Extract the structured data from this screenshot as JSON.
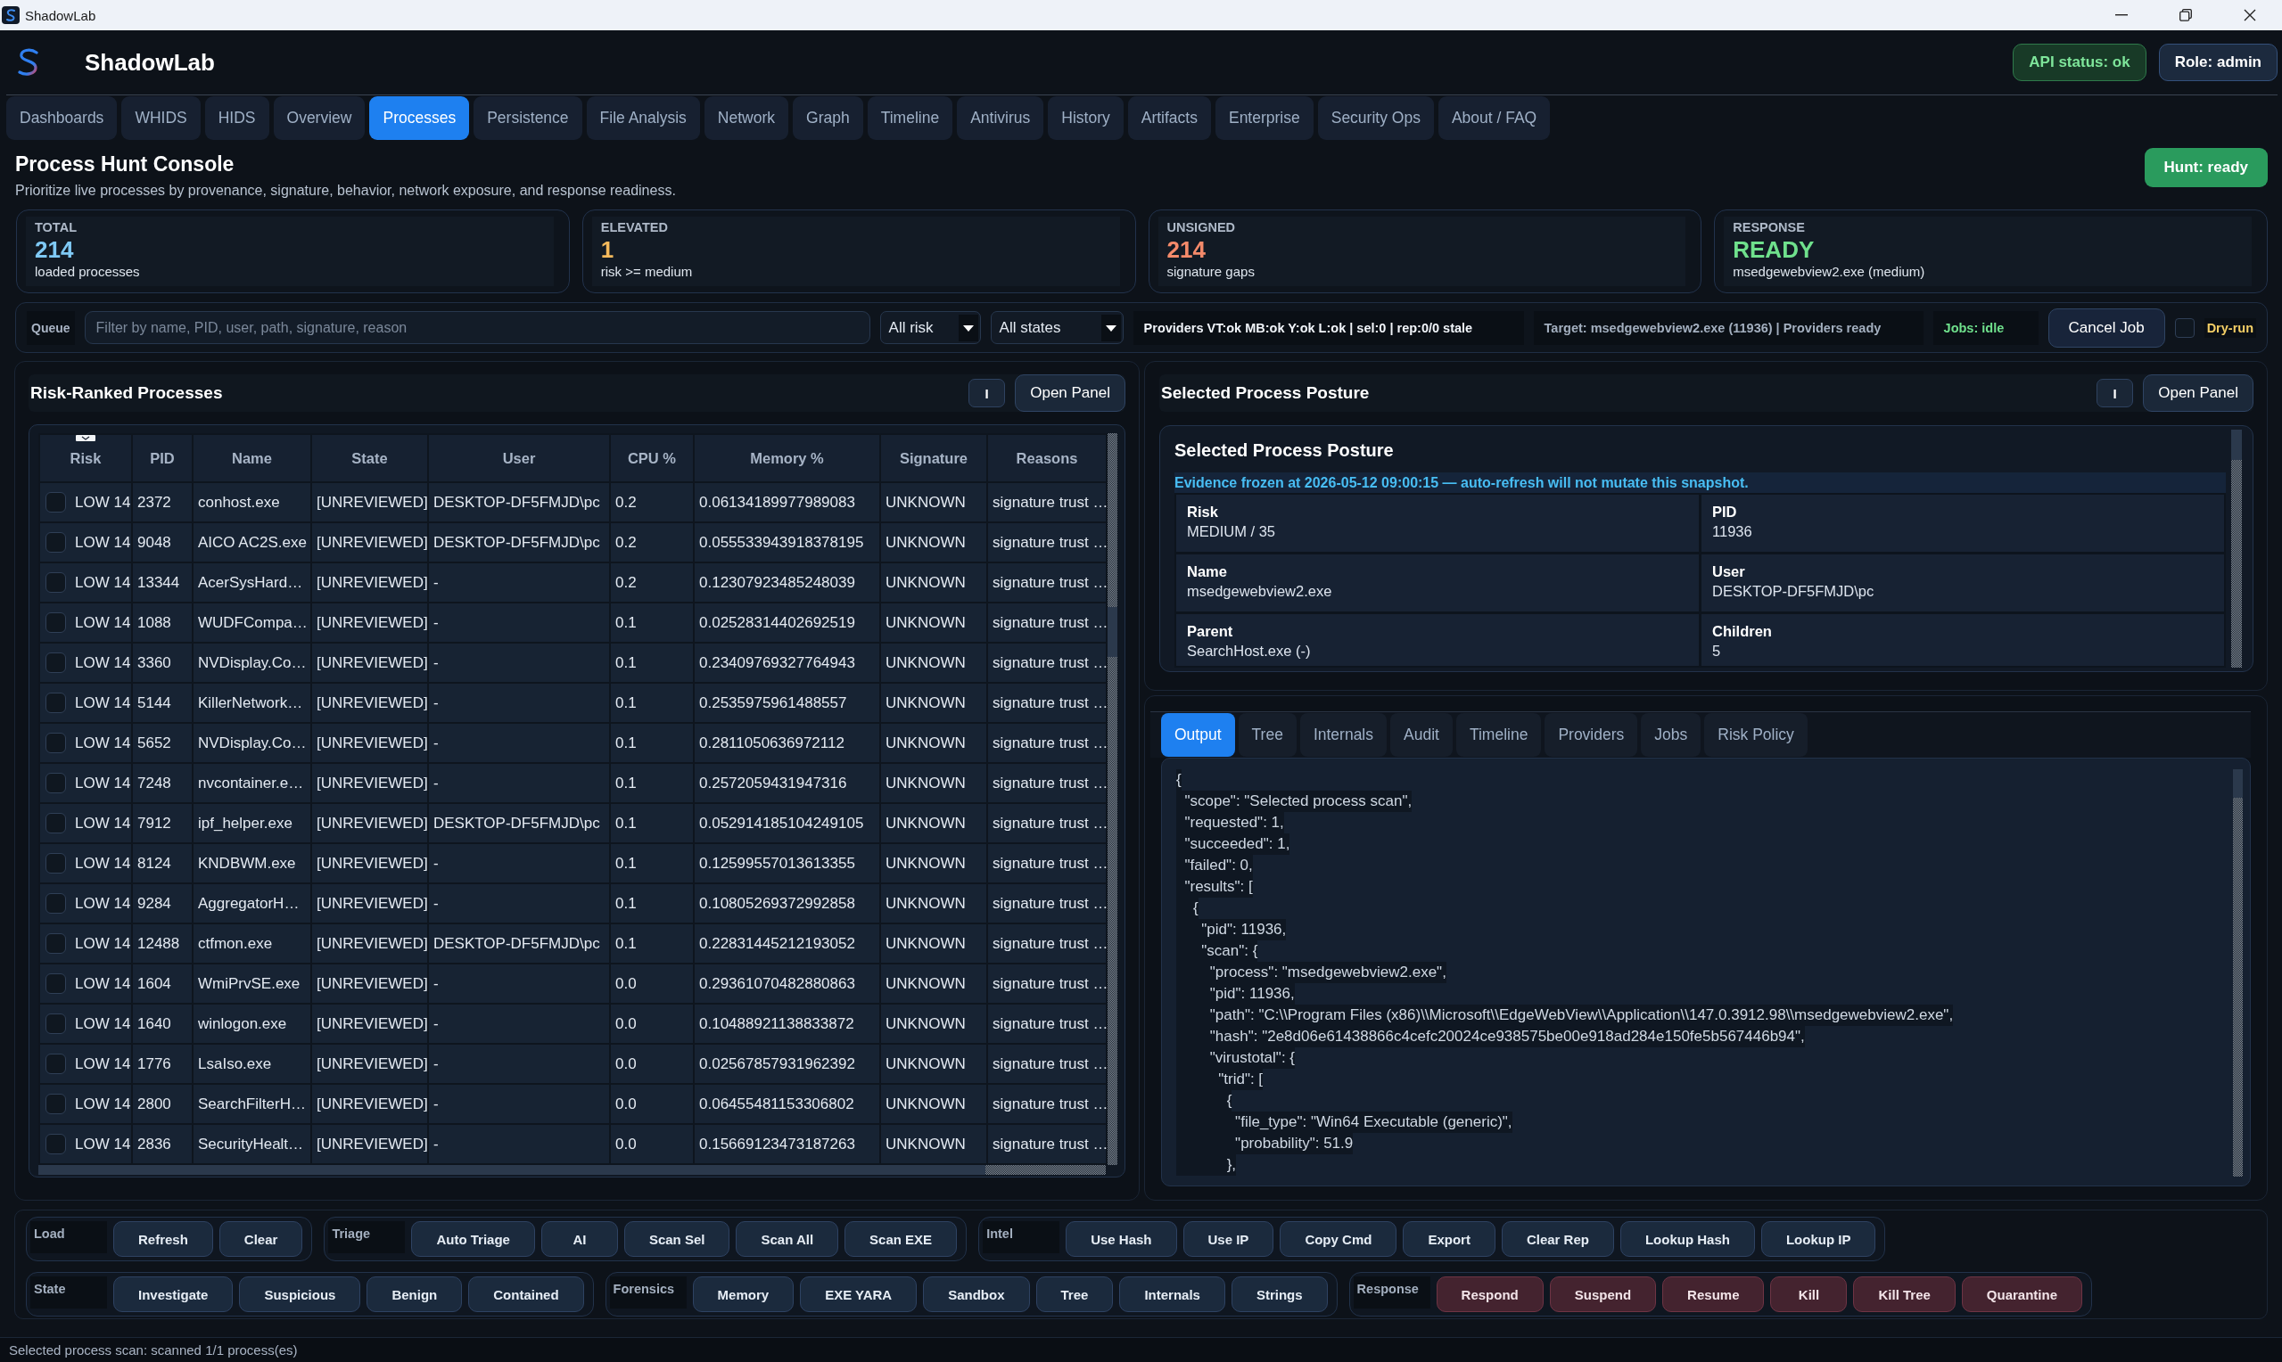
{
  "window": {
    "title": "ShadowLab"
  },
  "header": {
    "title": "ShadowLab",
    "badges": [
      {
        "label": "API status: ok",
        "kind": "ok"
      },
      {
        "label": "Role: admin",
        "kind": "neutral"
      }
    ]
  },
  "tabs": [
    {
      "label": "Dashboards",
      "selected": false
    },
    {
      "label": "WHIDS",
      "selected": false
    },
    {
      "label": "HIDS",
      "selected": false
    },
    {
      "label": "Overview",
      "selected": false
    },
    {
      "label": "Processes",
      "selected": true
    },
    {
      "label": "Persistence",
      "selected": false
    },
    {
      "label": "File Analysis",
      "selected": false
    },
    {
      "label": "Network",
      "selected": false
    },
    {
      "label": "Graph",
      "selected": false
    },
    {
      "label": "Timeline",
      "selected": false
    },
    {
      "label": "Antivirus",
      "selected": false
    },
    {
      "label": "History",
      "selected": false
    },
    {
      "label": "Artifacts",
      "selected": false
    },
    {
      "label": "Enterprise",
      "selected": false
    },
    {
      "label": "Security Ops",
      "selected": false
    },
    {
      "label": "About / FAQ",
      "selected": false
    }
  ],
  "page": {
    "title": "Process Hunt Console",
    "subtitle": "Prioritize live processes by provenance, signature, behavior, network exposure, and response readiness.",
    "status_button": "Hunt: ready"
  },
  "stats": [
    {
      "label": "TOTAL",
      "value": "214",
      "note": "loaded processes",
      "color": "#7fc9f5"
    },
    {
      "label": "ELEVATED",
      "value": "1",
      "note": "risk >= medium",
      "color": "#f4b95c"
    },
    {
      "label": "UNSIGNED",
      "value": "214",
      "note": "signature gaps",
      "color": "#f48a6a"
    },
    {
      "label": "RESPONSE",
      "value": "READY",
      "note": "msedgewebview2.exe (medium)",
      "color": "#6fe08c"
    }
  ],
  "queue": {
    "label": "Queue",
    "filter": {
      "placeholder": "Filter by name, PID, user, path, signature, reason"
    },
    "selects": [
      "All risk",
      "All states"
    ],
    "indicators": [
      {
        "text": "Providers VT:ok MB:ok Y:ok L:ok | sel:0 | rep:0/0 stale",
        "kind": "providers"
      },
      {
        "text": "Target: msedgewebview2.exe (11936) | Providers ready",
        "kind": "target"
      },
      {
        "text": "Jobs: idle",
        "kind": "jobs"
      }
    ],
    "cancel_button": "Cancel Job",
    "dry_run": {
      "label": "Dry-run",
      "checked": false
    }
  },
  "process_panel": {
    "title": "Risk-Ranked Processes",
    "buttons": [
      "I",
      "Open Panel"
    ],
    "table": {
      "columns": [
        "Risk",
        "PID",
        "Name",
        "State",
        "User",
        "CPU %",
        "Memory %",
        "Signature",
        "Reasons"
      ],
      "rows": [
        {
          "checked": false,
          "cells": [
            "LOW 14",
            "2372",
            "conhost.exe",
            "[UNREVIEWED]",
            "DESKTOP-DF5FMJD\\pc",
            "0.2",
            "0.06134189977989083",
            "UNKNOWN",
            "signature trust …"
          ]
        },
        {
          "checked": false,
          "cells": [
            "LOW 14",
            "9048",
            "AICO AC2S.exe",
            "[UNREVIEWED]",
            "DESKTOP-DF5FMJD\\pc",
            "0.2",
            "0.055533943918378195",
            "UNKNOWN",
            "signature trust …"
          ]
        },
        {
          "checked": false,
          "cells": [
            "LOW 14",
            "13344",
            "AcerSysHard…",
            "[UNREVIEWED]",
            "-",
            "0.2",
            "0.12307923485248039",
            "UNKNOWN",
            "signature trust …"
          ]
        },
        {
          "checked": false,
          "cells": [
            "LOW 14",
            "1088",
            "WUDFCompa…",
            "[UNREVIEWED]",
            "-",
            "0.1",
            "0.02528314402692519",
            "UNKNOWN",
            "signature trust …"
          ]
        },
        {
          "checked": false,
          "cells": [
            "LOW 14",
            "3360",
            "NVDisplay.Co…",
            "[UNREVIEWED]",
            "-",
            "0.1",
            "0.23409769327764943",
            "UNKNOWN",
            "signature trust …"
          ]
        },
        {
          "checked": false,
          "cells": [
            "LOW 14",
            "5144",
            "KillerNetwork…",
            "[UNREVIEWED]",
            "-",
            "0.1",
            "0.2535975961488557",
            "UNKNOWN",
            "signature trust …"
          ]
        },
        {
          "checked": false,
          "cells": [
            "LOW 14",
            "5652",
            "NVDisplay.Co…",
            "[UNREVIEWED]",
            "-",
            "0.1",
            "0.2811050636972112",
            "UNKNOWN",
            "signature trust …"
          ]
        },
        {
          "checked": false,
          "cells": [
            "LOW 14",
            "7248",
            "nvcontainer.e…",
            "[UNREVIEWED]",
            "-",
            "0.1",
            "0.2572059431947316",
            "UNKNOWN",
            "signature trust …"
          ]
        },
        {
          "checked": false,
          "cells": [
            "LOW 14",
            "7912",
            "ipf_helper.exe",
            "[UNREVIEWED]",
            "DESKTOP-DF5FMJD\\pc",
            "0.1",
            "0.052914185104249105",
            "UNKNOWN",
            "signature trust …"
          ]
        },
        {
          "checked": false,
          "cells": [
            "LOW 14",
            "8124",
            "KNDBWM.exe",
            "[UNREVIEWED]",
            "-",
            "0.1",
            "0.12599557013613355",
            "UNKNOWN",
            "signature trust …"
          ]
        },
        {
          "checked": false,
          "cells": [
            "LOW 14",
            "9284",
            "AggregatorH…",
            "[UNREVIEWED]",
            "-",
            "0.1",
            "0.10805269372992858",
            "UNKNOWN",
            "signature trust …"
          ]
        },
        {
          "checked": false,
          "cells": [
            "LOW 14",
            "12488",
            "ctfmon.exe",
            "[UNREVIEWED]",
            "DESKTOP-DF5FMJD\\pc",
            "0.1",
            "0.22831445212193052",
            "UNKNOWN",
            "signature trust …"
          ]
        },
        {
          "checked": false,
          "cells": [
            "LOW 14",
            "1604",
            "WmiPrvSE.exe",
            "[UNREVIEWED]",
            "-",
            "0.0",
            "0.29361070482880863",
            "UNKNOWN",
            "signature trust …"
          ]
        },
        {
          "checked": false,
          "cells": [
            "LOW 14",
            "1640",
            "winlogon.exe",
            "[UNREVIEWED]",
            "-",
            "0.0",
            "0.10488921138833872",
            "UNKNOWN",
            "signature trust …"
          ]
        },
        {
          "checked": false,
          "cells": [
            "LOW 14",
            "1776",
            "LsaIso.exe",
            "[UNREVIEWED]",
            "-",
            "0.0",
            "0.02567857931962392",
            "UNKNOWN",
            "signature trust …"
          ]
        },
        {
          "checked": false,
          "cells": [
            "LOW 14",
            "2800",
            "SearchFilterH…",
            "[UNREVIEWED]",
            "-",
            "0.0",
            "0.06455481153306802",
            "UNKNOWN",
            "signature trust …"
          ]
        },
        {
          "checked": false,
          "cells": [
            "LOW 14",
            "2836",
            "SecurityHealt…",
            "[UNREVIEWED]",
            "-",
            "0.0",
            "0.15669123473187263",
            "UNKNOWN",
            "signature trust …"
          ]
        }
      ]
    }
  },
  "posture_panel": {
    "title": "Selected Process Posture",
    "buttons": [
      "I",
      "Open Panel"
    ],
    "card_title": "Selected Process Posture",
    "notice": "Evidence frozen at 2026-05-12 09:00:15 — auto-refresh will not mutate this snapshot.",
    "fields": [
      {
        "label": "Risk",
        "value": "MEDIUM / 35"
      },
      {
        "label": "PID",
        "value": "11936"
      },
      {
        "label": "Name",
        "value": "msedgewebview2.exe"
      },
      {
        "label": "User",
        "value": "DESKTOP-DF5FMJD\\pc"
      },
      {
        "label": "Parent",
        "value": "SearchHost.exe (-)"
      },
      {
        "label": "Children",
        "value": "5"
      }
    ]
  },
  "detail_tabs": [
    {
      "label": "Output",
      "selected": true
    },
    {
      "label": "Tree",
      "selected": false
    },
    {
      "label": "Internals",
      "selected": false
    },
    {
      "label": "Audit",
      "selected": false
    },
    {
      "label": "Timeline",
      "selected": false
    },
    {
      "label": "Providers",
      "selected": false
    },
    {
      "label": "Jobs",
      "selected": false
    },
    {
      "label": "Risk Policy",
      "selected": false
    }
  ],
  "output": {
    "lines": [
      "{",
      "  \"scope\": \"Selected process scan\",",
      "  \"requested\": 1,",
      "  \"succeeded\": 1,",
      "  \"failed\": 0,",
      "  \"results\": [",
      "    {",
      "      \"pid\": 11936,",
      "      \"scan\": {",
      "        \"process\": \"msedgewebview2.exe\",",
      "        \"pid\": 11936,",
      "        \"path\": \"C:\\\\Program Files (x86)\\\\Microsoft\\\\EdgeWebView\\\\Application\\\\147.0.3912.98\\\\msedgewebview2.exe\",",
      "        \"hash\": \"2e8d06e61438866c4cefc20024ce938575be00e918ad284e150fe5b567446b94\",",
      "        \"virustotal\": {",
      "          \"trid\": [",
      "            {",
      "              \"file_type\": \"Win64 Executable (generic)\",",
      "              \"probability\": 51.9",
      "            },"
    ]
  },
  "action_rows": [
    [
      {
        "label": "Load",
        "kind": "normal",
        "buttons": [
          "Refresh",
          "Clear"
        ]
      },
      {
        "label": "Triage",
        "kind": "normal",
        "buttons": [
          "Auto Triage",
          "AI",
          "Scan Sel",
          "Scan All",
          "Scan EXE"
        ]
      },
      {
        "label": "Intel",
        "kind": "normal",
        "buttons": [
          "Use Hash",
          "Use IP",
          "Copy Cmd",
          "Export",
          "Clear Rep",
          "Lookup Hash",
          "Lookup IP"
        ]
      }
    ],
    [
      {
        "label": "State",
        "kind": "normal",
        "buttons": [
          "Investigate",
          "Suspicious",
          "Benign",
          "Contained"
        ]
      },
      {
        "label": "Forensics",
        "kind": "normal",
        "buttons": [
          "Memory",
          "EXE YARA",
          "Sandbox",
          "Tree",
          "Internals",
          "Strings"
        ]
      },
      {
        "label": "Response",
        "kind": "danger",
        "buttons": [
          "Respond",
          "Suspend",
          "Resume",
          "Kill",
          "Kill Tree",
          "Quarantine"
        ]
      }
    ]
  ],
  "status_bar": "Selected process scan: scanned 1/1 process(es)"
}
